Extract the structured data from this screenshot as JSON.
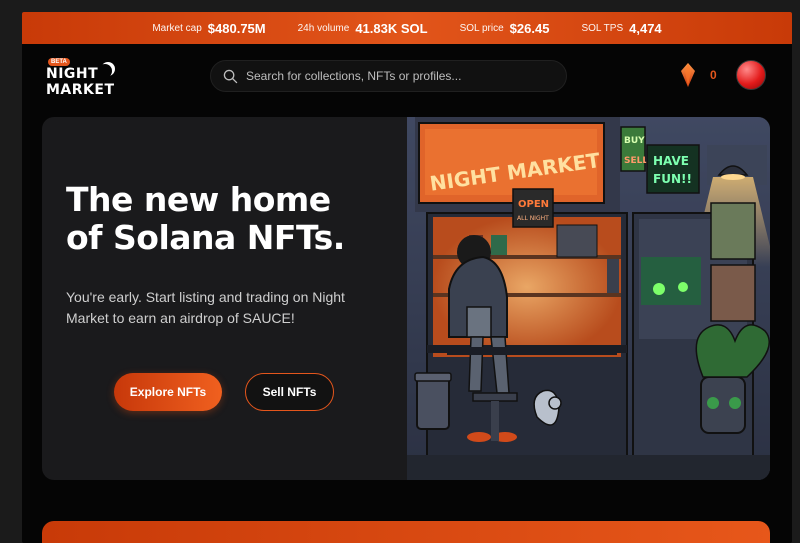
{
  "stats": [
    {
      "label": "Market cap",
      "value": "$480.75M"
    },
    {
      "label": "24h volume",
      "value": "41.83K SOL"
    },
    {
      "label": "SOL price",
      "value": "$26.45"
    },
    {
      "label": "SOL TPS",
      "value": "4,474"
    }
  ],
  "logo": {
    "badge": "BETA",
    "line1": "NIGHT",
    "line2": "MARKET"
  },
  "search": {
    "placeholder": "Search for collections, NFTs or profiles..."
  },
  "wallet": {
    "gem_count": "0"
  },
  "hero": {
    "title_line1": "The new home",
    "title_line2": "of Solana NFTs.",
    "subtitle": "You're early. Start listing and trading on Night Market to earn an airdrop of SAUCE!",
    "primary_button": "Explore NFTs",
    "secondary_button": "Sell NFTs"
  },
  "illustration": {
    "sign": "NIGHT MARKET",
    "buy_sell": [
      "BUY",
      "SELL"
    ],
    "have_fun": [
      "HAVE",
      "FUN!!"
    ],
    "open_sign": [
      "OPEN",
      "ALL NIGHT"
    ]
  },
  "colors": {
    "accent": "#e4561c",
    "background": "#050505",
    "card": "#1a1a1c"
  }
}
